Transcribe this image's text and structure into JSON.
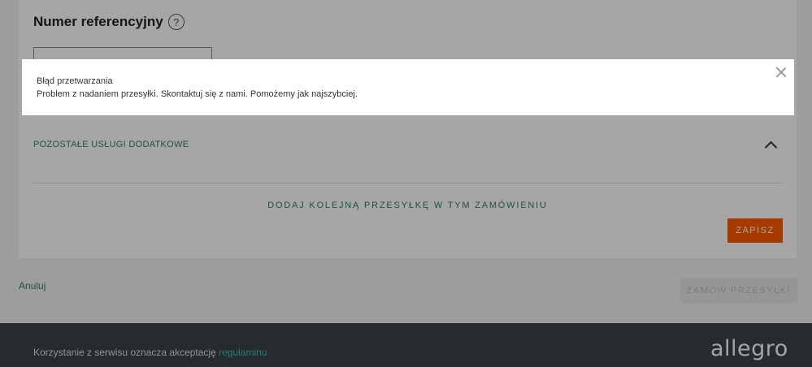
{
  "form": {
    "reference_title": "Numer referencyjny",
    "help_icon": "?",
    "extras_label": "POZOSTAŁE USŁUGI DODATKOWE",
    "add_shipment": "DODAJ KOLEJNĄ PRZESYŁKĘ W TYM ZAMÓWIENIU",
    "save_label": "ZAPISZ"
  },
  "actions": {
    "cancel_label": "Anuluj",
    "order_label": "ZAMÓW PRZESYŁKI"
  },
  "footer": {
    "text": "Korzystanie z serwisu oznacza akceptację ",
    "link": "regulaminu",
    "logo": "allegro"
  },
  "modal": {
    "title": "Błąd przetwarzania",
    "message": "Problem z nadaniem przesyłki. Skontaktuj się z nami. Pomożemy jak najszybciej."
  },
  "colors": {
    "accent": "#ff5a00",
    "link": "#2a7e70",
    "footer_bg": "#3a4247"
  }
}
